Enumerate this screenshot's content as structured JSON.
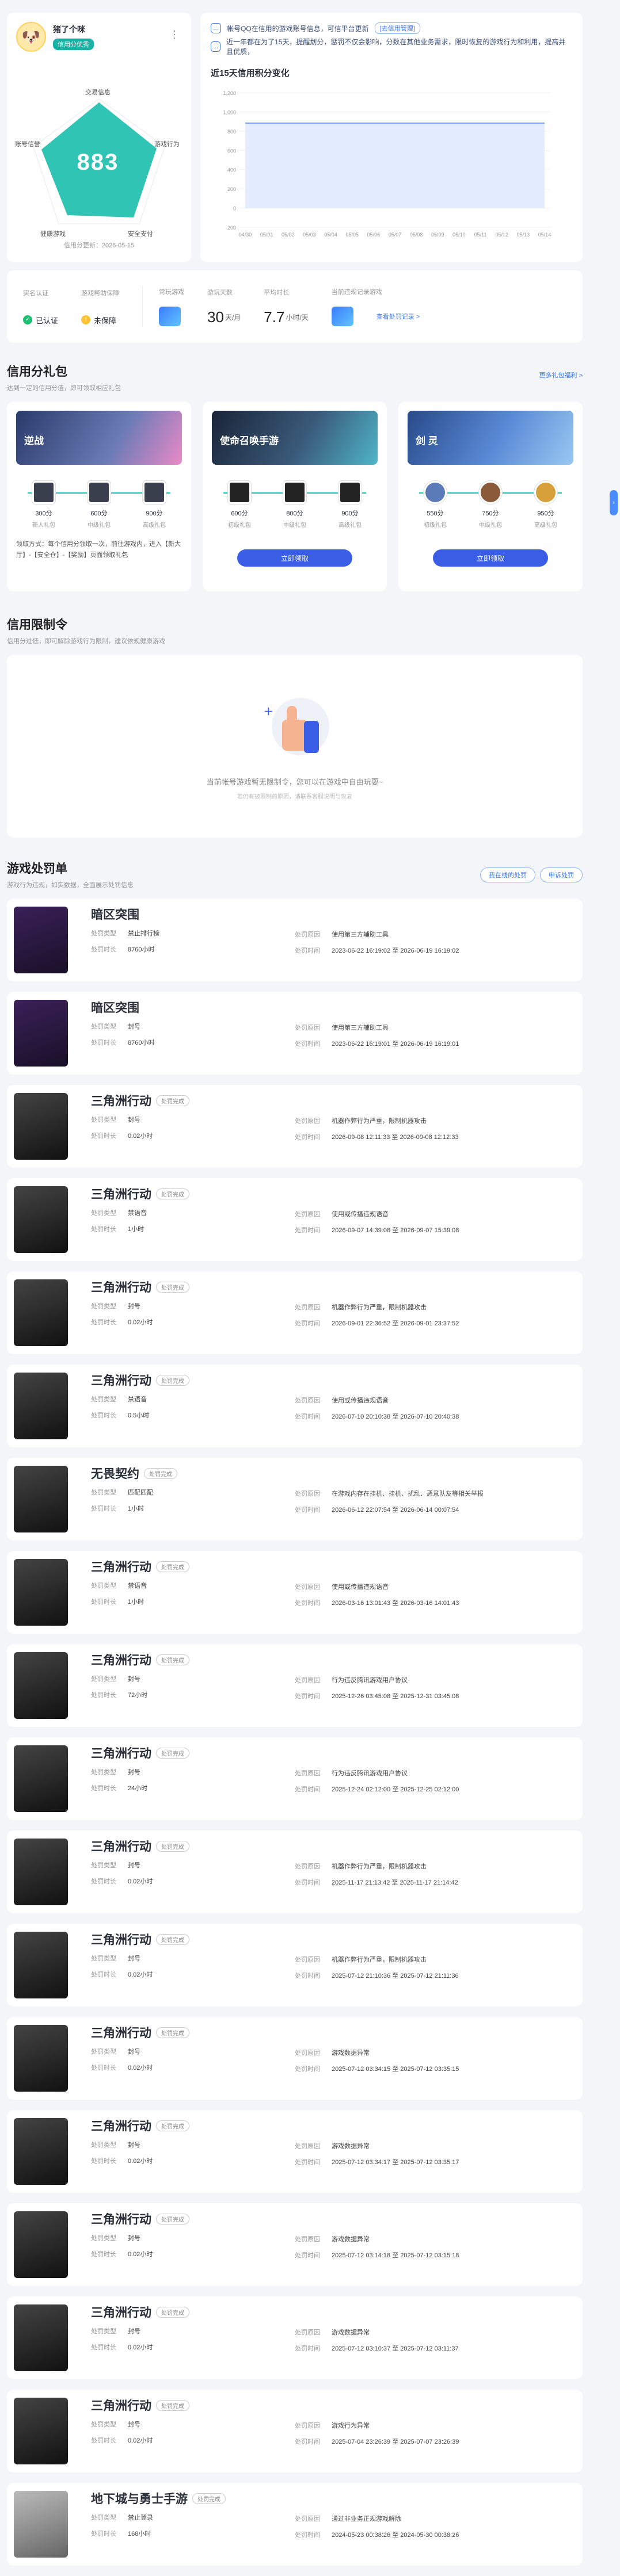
{
  "profile": {
    "name": "猪了个咪",
    "badge": "信用分优秀",
    "score": "883",
    "labels": [
      "交易信息",
      "账号信誉",
      "游戏行为",
      "健康游戏",
      "安全支付"
    ],
    "update": "信用分更新：2026-05-15"
  },
  "notices": [
    {
      "text": "帐号QQ在信用的游戏账号信息，可信平台更新",
      "link": "[去信用管理]"
    },
    {
      "text": "近一年都在为了15天，提醒划分，惩罚不仅会影响，分数在其他业务需求，限时恢复的游戏行为和利用，提高并且优质，"
    }
  ],
  "chart": {
    "title": "近15天信用积分变化",
    "xlabels": [
      "04/30",
      "05/01",
      "05/02",
      "05/03",
      "05/04",
      "05/05",
      "05/06",
      "05/07",
      "05/08",
      "05/09",
      "05/10",
      "05/11",
      "05/12",
      "05/13",
      "05/14"
    ],
    "yticks": [
      "1,200",
      "1,000",
      "800",
      "600",
      "400",
      "200",
      "0",
      "-200"
    ]
  },
  "stats": {
    "auth_label": "实名认证",
    "auth_val": "已认证",
    "guard_label": "游戏帮助保障",
    "guard_val": "未保障",
    "game_label": "常玩游戏",
    "days_label": "游玩天数",
    "days_val": "30",
    "days_unit": "天/月",
    "hours_label": "平均时长",
    "hours_val": "7.7",
    "hours_unit": "小时/天",
    "recent_label": "当前违规记录游戏",
    "recent_link": "查看处罚记录 >"
  },
  "gifts": {
    "title": "信用分礼包",
    "sub": "达到一定的信用分值，即可领取相应礼包",
    "link": "更多礼包福利 >",
    "cards": [
      {
        "name": "逆战",
        "rewards": [
          {
            "v": "300分",
            "s": "新人礼包"
          },
          {
            "v": "600分",
            "s": "中级礼包"
          },
          {
            "v": "900分",
            "s": "高级礼包"
          }
        ],
        "desc": "领取方式：每个信用分领取一次，前往游戏内，进入【新大厅】-【安全仓】-【奖励】页面领取礼包"
      },
      {
        "name": "使命召唤手游",
        "rewards": [
          {
            "v": "600分",
            "s": "初级礼包"
          },
          {
            "v": "800分",
            "s": "中级礼包"
          },
          {
            "v": "900分",
            "s": "高级礼包"
          }
        ],
        "btn": "立即领取"
      },
      {
        "name": "剑 灵",
        "rewards": [
          {
            "v": "550分",
            "s": "初级礼包"
          },
          {
            "v": "750分",
            "s": "中级礼包"
          },
          {
            "v": "950分",
            "s": "高级礼包"
          }
        ],
        "btn": "立即领取"
      }
    ]
  },
  "restrict": {
    "title": "信用限制令",
    "sub": "信用分过低，即可解除游戏行为限制，建议依规健康游戏",
    "empty": "当前帐号游戏暂无限制令，您可以在游戏中自由玩耍~",
    "empty_sub": "若仍有被限制的原因，请联系客服说明与恢复"
  },
  "penalty": {
    "title": "游戏处罚单",
    "sub": "游戏行为违规，如实数据，全面展示处罚信息",
    "btn1": "我在线的处罚",
    "btn2": "申诉处罚",
    "items": [
      {
        "game": "暗区突围",
        "tag": "",
        "type": "禁止排行榜",
        "dur": "8760小时",
        "reason": "使用第三方辅助工具",
        "time": "2023-06-22 16:19:02 至 2026-06-19 16:19:02",
        "cls": "dark"
      },
      {
        "game": "暗区突围",
        "tag": "",
        "type": "封号",
        "dur": "8760小时",
        "reason": "使用第三方辅助工具",
        "time": "2023-06-22 16:19:01 至 2026-06-19 16:19:01",
        "cls": "dark"
      },
      {
        "game": "三角洲行动",
        "tag": "处罚完成",
        "type": "封号",
        "dur": "0.02小时",
        "reason": "机器作弊行为严重，限制机器攻击",
        "time": "2026-09-08 12:11:33 至 2026-09-08 12:12:33",
        "cls": "gray"
      },
      {
        "game": "三角洲行动",
        "tag": "处罚完成",
        "type": "禁语音",
        "dur": "1小时",
        "reason": "使用或传播违规语音",
        "time": "2026-09-07 14:39:08 至 2026-09-07 15:39:08",
        "cls": "gray"
      },
      {
        "game": "三角洲行动",
        "tag": "处罚完成",
        "type": "封号",
        "dur": "0.02小时",
        "reason": "机器作弊行为严重，限制机器攻击",
        "time": "2026-09-01 22:36:52 至 2026-09-01 23:37:52",
        "cls": "gray"
      },
      {
        "game": "三角洲行动",
        "tag": "处罚完成",
        "type": "禁语音",
        "dur": "0.5小时",
        "reason": "使用或传播违规语音",
        "time": "2026-07-10 20:10:38 至 2026-07-10 20:40:38",
        "cls": "gray"
      },
      {
        "game": "无畏契约",
        "tag": "处罚完成",
        "type": "匹配匹配",
        "dur": "1小时",
        "reason": "在游戏内存在挂机、挂机、扰乱、恶意队友等相关举报",
        "time": "2026-06-12 22:07:54 至 2026-06-14 00:07:54",
        "cls": "gray"
      },
      {
        "game": "三角洲行动",
        "tag": "处罚完成",
        "type": "禁语音",
        "dur": "1小时",
        "reason": "使用或传播违规语音",
        "time": "2026-03-16 13:01:43 至 2026-03-16 14:01:43",
        "cls": "gray"
      },
      {
        "game": "三角洲行动",
        "tag": "处罚完成",
        "type": "封号",
        "dur": "72小时",
        "reason": "行为违反腾讯游戏用户协议",
        "time": "2025-12-26 03:45:08 至 2025-12-31 03:45:08",
        "cls": "gray"
      },
      {
        "game": "三角洲行动",
        "tag": "处罚完成",
        "type": "封号",
        "dur": "24小时",
        "reason": "行为违反腾讯游戏用户协议",
        "time": "2025-12-24 02:12:00 至 2025-12-25 02:12:00",
        "cls": "gray"
      },
      {
        "game": "三角洲行动",
        "tag": "处罚完成",
        "type": "封号",
        "dur": "0.02小时",
        "reason": "机器作弊行为严重，限制机器攻击",
        "time": "2025-11-17 21:13:42 至 2025-11-17 21:14:42",
        "cls": "gray"
      },
      {
        "game": "三角洲行动",
        "tag": "处罚完成",
        "type": "封号",
        "dur": "0.02小时",
        "reason": "机器作弊行为严重，限制机器攻击",
        "time": "2025-07-12 21:10:36 至 2025-07-12 21:11:36",
        "cls": "gray"
      },
      {
        "game": "三角洲行动",
        "tag": "处罚完成",
        "type": "封号",
        "dur": "0.02小时",
        "reason": "游戏数据异常",
        "time": "2025-07-12 03:34:15 至 2025-07-12 03:35:15",
        "cls": "gray"
      },
      {
        "game": "三角洲行动",
        "tag": "处罚完成",
        "type": "封号",
        "dur": "0.02小时",
        "reason": "游戏数据异常",
        "time": "2025-07-12 03:34:17 至 2025-07-12 03:35:17",
        "cls": "gray"
      },
      {
        "game": "三角洲行动",
        "tag": "处罚完成",
        "type": "封号",
        "dur": "0.02小时",
        "reason": "游戏数据异常",
        "time": "2025-07-12 03:14:18 至 2025-07-12 03:15:18",
        "cls": "gray"
      },
      {
        "game": "三角洲行动",
        "tag": "处罚完成",
        "type": "封号",
        "dur": "0.02小时",
        "reason": "游戏数据异常",
        "time": "2025-07-12 03:10:37 至 2025-07-12 03:11:37",
        "cls": "gray"
      },
      {
        "game": "三角洲行动",
        "tag": "处罚完成",
        "type": "封号",
        "dur": "0.02小时",
        "reason": "游戏行为异常",
        "time": "2025-07-04 23:26:39 至 2025-07-07 23:26:39",
        "cls": "gray"
      },
      {
        "game": "地下城与勇士手游",
        "tag": "处罚完成",
        "type": "禁止登录",
        "dur": "168小时",
        "reason": "通过非业务正规游戏解除",
        "time": "2024-05-23 00:38:26 至 2024-05-30 00:38:26",
        "cls": "light"
      }
    ],
    "k_type": "处罚类型",
    "k_dur": "处罚时长",
    "k_reason": "处罚原因",
    "k_time": "处罚时间"
  },
  "colors": {
    "accent": "#3a5fe6",
    "teal": "#18b3a5"
  }
}
